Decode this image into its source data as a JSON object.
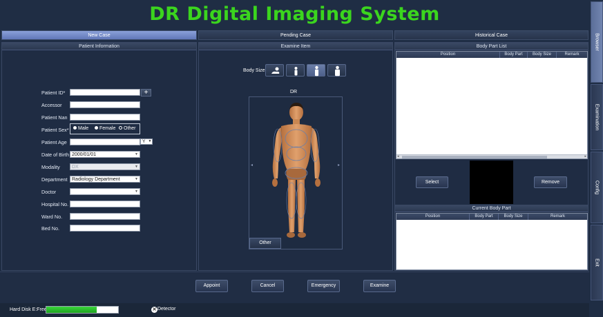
{
  "app": {
    "title": "DR Digital Imaging System"
  },
  "tabs": [
    {
      "label": "New Case",
      "active": true
    },
    {
      "label": "Pending Case",
      "active": false
    },
    {
      "label": "Historical Case",
      "active": false
    }
  ],
  "patient_panel": {
    "header": "Patient Information",
    "fields": {
      "patient_id": {
        "label": "Patient ID*",
        "value": ""
      },
      "accessor": {
        "label": "Accessor",
        "value": ""
      },
      "patient_name": {
        "label": "Patient Nan",
        "value": ""
      },
      "patient_sex": {
        "label": "Patient Sex*",
        "options": [
          "Male",
          "Female",
          "Other"
        ]
      },
      "patient_age": {
        "label": "Patient Age",
        "value": "",
        "unit": "Y"
      },
      "date_of_birth": {
        "label": "Date of Birth",
        "value": "2000/01/01"
      },
      "modality": {
        "label": "Modality",
        "value": "DX"
      },
      "department": {
        "label": "Department",
        "value": "Radiology Department"
      },
      "doctor": {
        "label": "Doctor",
        "value": ""
      },
      "hospital_no": {
        "label": "Hospital No.",
        "value": ""
      },
      "ward_no": {
        "label": "Ward No.",
        "value": ""
      },
      "bed_no": {
        "label": "Bed No.",
        "value": ""
      }
    }
  },
  "examine_panel": {
    "header": "Examine Item",
    "body_size_label": "Body Size",
    "body_sizes": [
      "infant-icon",
      "child-icon",
      "adult-icon",
      "large-adult-icon"
    ],
    "dr_label": "DR",
    "other_button": "Other",
    "prev_arrow": "◂",
    "next_arrow": "▸"
  },
  "body_part_panel": {
    "header": "Body Part List",
    "columns": [
      "Position",
      "Body Part",
      "Body Size",
      "Remark"
    ],
    "select_button": "Select",
    "remove_button": "Remove",
    "current_header": "Current Body Part",
    "current_columns": [
      "Position",
      "Body Part",
      "Body Size",
      "Remark"
    ]
  },
  "actions": {
    "appoint": "Appoint",
    "cancel": "Cancel",
    "emergency": "Emergency",
    "examine": "Examine"
  },
  "status": {
    "disk_label": "Hard Disk E:Free",
    "disk_free_fraction": 0.7,
    "detector_label": "Detector"
  },
  "side_tabs": [
    {
      "label": "Browser",
      "active": true
    },
    {
      "label": "Examination",
      "active": false
    },
    {
      "label": "Config",
      "active": false
    },
    {
      "label": "Exit",
      "active": false
    }
  ],
  "colors": {
    "title_green": "#3bd51e",
    "active_tab": "#7589c6",
    "background": "#1f2d44",
    "disk_green": "#2cc42d"
  }
}
